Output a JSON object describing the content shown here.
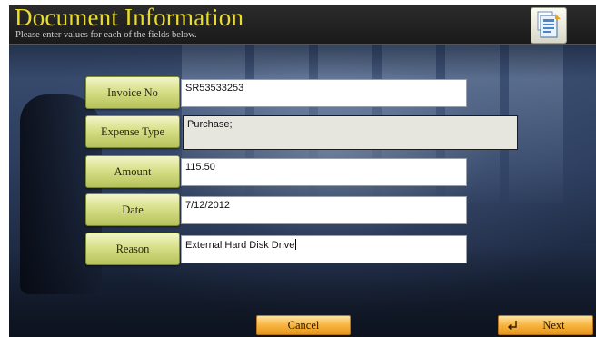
{
  "header": {
    "title": "Document Information",
    "subtitle": "Please enter values for each of the fields below.",
    "icon": "document-form-icon"
  },
  "form": {
    "fields": [
      {
        "label": "Invoice No",
        "value": "SR53533253",
        "readonly": false
      },
      {
        "label": "Expense Type",
        "value": "Purchase;",
        "readonly": true
      },
      {
        "label": "Amount",
        "value": "115.50",
        "readonly": false
      },
      {
        "label": "Date",
        "value": "7/12/2012",
        "readonly": false
      },
      {
        "label": "Reason",
        "value": "External Hard Disk Drive",
        "readonly": false
      }
    ]
  },
  "footer": {
    "cancel_label": "Cancel",
    "next_label": "Next",
    "next_icon": "enter-arrow-icon"
  },
  "colors": {
    "title": "#e9dc2a",
    "label_button": "#d7df88",
    "action_button": "#f7b640",
    "header_bg": "#222222"
  }
}
